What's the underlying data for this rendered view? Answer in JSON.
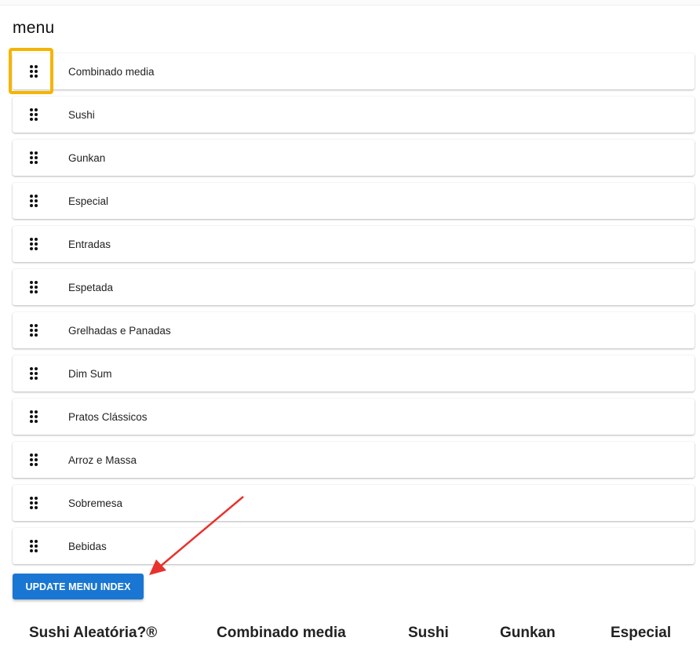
{
  "page": {
    "title": "menu"
  },
  "menu_items": [
    {
      "label": "Combinado media"
    },
    {
      "label": "Sushi"
    },
    {
      "label": "Gunkan"
    },
    {
      "label": "Especial"
    },
    {
      "label": "Entradas"
    },
    {
      "label": "Espetada"
    },
    {
      "label": "Grelhadas e Panadas"
    },
    {
      "label": "Dim Sum"
    },
    {
      "label": "Pratos Clássicos"
    },
    {
      "label": "Arroz e Massa"
    },
    {
      "label": "Sobremesa"
    },
    {
      "label": "Bebidas"
    }
  ],
  "update_button": {
    "label": "UPDATE MENU INDEX"
  },
  "footer_nav": [
    {
      "label": "Sushi Aleatória?®"
    },
    {
      "label": "Combinado media"
    },
    {
      "label": "Sushi"
    },
    {
      "label": "Gunkan"
    },
    {
      "label": "Especial"
    }
  ],
  "icons": {
    "drag_handle": "drag-handle-icon",
    "annotation_arrow": "arrow-icon"
  },
  "colors": {
    "accent": "#1976d2",
    "highlight": "#f5b400",
    "annotation": "#e8322d"
  }
}
